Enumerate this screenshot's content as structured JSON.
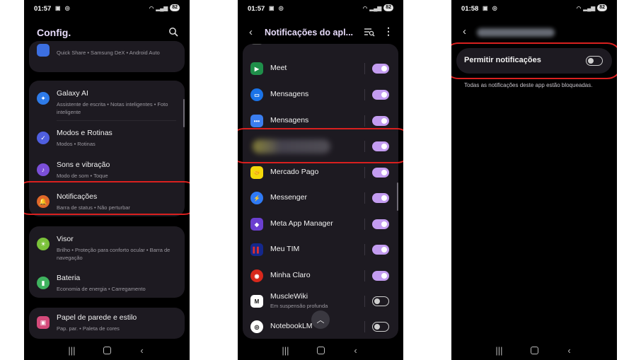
{
  "screens": [
    {
      "status": {
        "time": "01:57",
        "icons": "▣ ◎",
        "battery": "82"
      },
      "title": "Config.",
      "items": [
        {
          "title": "",
          "subtitle": "Quick Share  •  Samsung DeX  •  Android Auto",
          "icon": "connected-devices-icon",
          "color": "#3c6fe0"
        },
        {
          "title": "Galaxy AI",
          "subtitle": "Assistente de escrita  •  Notas inteligentes  •  Foto inteligente",
          "icon": "galaxy-ai-icon",
          "color": "#2e7be8"
        },
        {
          "title": "Modos e Rotinas",
          "subtitle": "Modos  •  Rotinas",
          "icon": "modes-routines-icon",
          "color": "#4f5fe0"
        },
        {
          "title": "Sons e vibração",
          "subtitle": "Modo de som  •  Toque",
          "icon": "sound-icon",
          "color": "#7b4fd8"
        },
        {
          "title": "Notificações",
          "subtitle": "Barra de status  •  Não perturbar",
          "icon": "bell-icon",
          "color": "#e0682a"
        },
        {
          "title": "Visor",
          "subtitle": "Brilho  •  Proteção para conforto ocular  •  Barra de navegação",
          "icon": "display-icon",
          "color": "#7bc23a"
        },
        {
          "title": "Bateria",
          "subtitle": "Economia de energia  •  Carregamento",
          "icon": "battery-icon",
          "color": "#3fb35f"
        },
        {
          "title": "Papel de parede e estilo",
          "subtitle": "Pap. par.  •  Paleta de cores",
          "icon": "wallpaper-icon",
          "color": "#d44a7a"
        }
      ]
    },
    {
      "status": {
        "time": "01:57",
        "icons": "▣ ◎",
        "battery": "82"
      },
      "title": "Notificações do apl...",
      "apps": [
        {
          "name": "",
          "sub": "",
          "on": true,
          "icon": "partial-app-icon",
          "color": "#555"
        },
        {
          "name": "Meet",
          "sub": "",
          "on": true,
          "icon": "meet-icon",
          "color": "#1f8f4a"
        },
        {
          "name": "Mensagens",
          "sub": "",
          "on": true,
          "icon": "google-messages-icon",
          "color": "#1a73e8"
        },
        {
          "name": "Mensagens",
          "sub": "",
          "on": true,
          "icon": "samsung-messages-icon",
          "color": "#3b7ef0"
        },
        {
          "name": "",
          "sub": "",
          "on": true,
          "icon": "blurred-app-icon",
          "color": "#8a8440"
        },
        {
          "name": "Mercado Pago",
          "sub": "",
          "on": true,
          "icon": "mercado-pago-icon",
          "color": "#f5d90a"
        },
        {
          "name": "Messenger",
          "sub": "",
          "on": true,
          "icon": "messenger-icon",
          "color": "#2f7af5"
        },
        {
          "name": "Meta App Manager",
          "sub": "",
          "on": true,
          "icon": "meta-app-manager-icon",
          "color": "#6b3fd0"
        },
        {
          "name": "Meu TIM",
          "sub": "",
          "on": true,
          "icon": "meu-tim-icon",
          "color": "#14288c"
        },
        {
          "name": "Minha Claro",
          "sub": "",
          "on": true,
          "icon": "minha-claro-icon",
          "color": "#d8281c"
        },
        {
          "name": "MuscleWiki",
          "sub": "Em suspensão profunda",
          "on": false,
          "icon": "musclewiki-icon",
          "color": "#ffffff"
        },
        {
          "name": "NotebookLM",
          "sub": "",
          "on": false,
          "icon": "notebooklm-icon",
          "color": "#ffffff"
        }
      ]
    },
    {
      "status": {
        "time": "01:58",
        "icons": "▣ ◎",
        "battery": "82"
      },
      "permit_label": "Permitir notificações",
      "permit_on": false,
      "description": "Todas as notificações deste app estão bloqueadas."
    }
  ],
  "nav": {
    "recents": "|||",
    "home": "",
    "back": "‹"
  },
  "colors": {
    "accent": "#c39cf0",
    "title": "#e8dcfb",
    "highlight": "#d9201f",
    "card": "#1d1a21"
  }
}
